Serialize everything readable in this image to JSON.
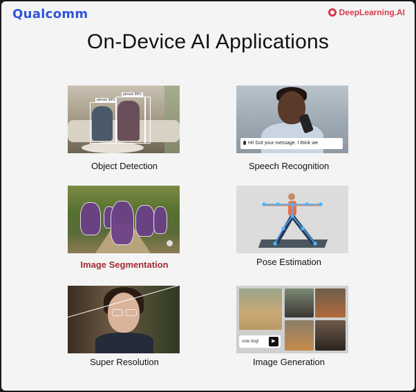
{
  "header": {
    "left_logo": "Qualcomm",
    "right_logo": "DeepLearning.AI",
    "title": "On-Device AI Applications"
  },
  "cards": [
    {
      "caption": "Object Detection",
      "active": false
    },
    {
      "caption": "Speech Recognition",
      "active": false
    },
    {
      "caption": "Image Segmentation",
      "active": true
    },
    {
      "caption": "Pose Estimation",
      "active": false
    },
    {
      "caption": "Super Resolution",
      "active": false
    },
    {
      "caption": "Image Generation",
      "active": false
    }
  ],
  "speech_bubble": "Hi! Got your message. I think we",
  "image_generation_prompt": "cute dog!",
  "object_detection_tags": [
    "person 96%",
    "person 95%"
  ],
  "colors": {
    "qualcomm_blue": "#3253dc",
    "deeplearning_red": "#d33b4b",
    "active_caption": "#9e2c36"
  }
}
